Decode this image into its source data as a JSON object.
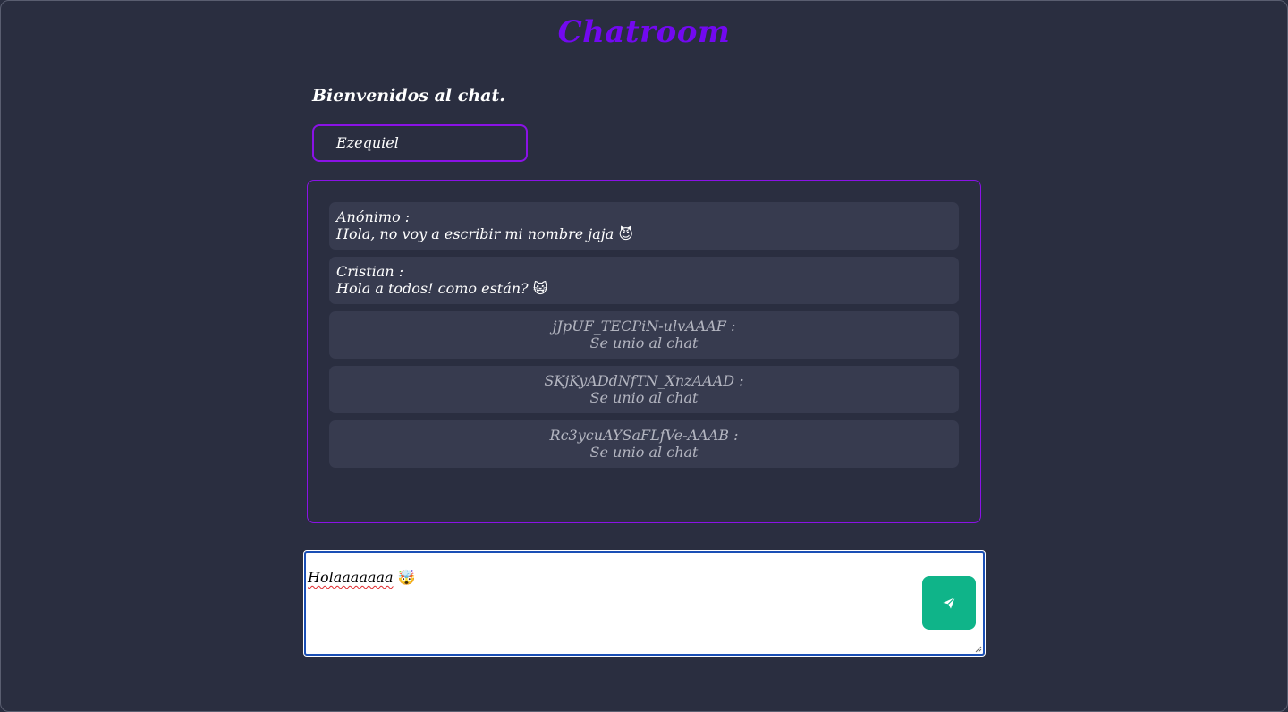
{
  "page": {
    "title": "Chatroom",
    "welcome": "Bienvenidos al chat."
  },
  "user": {
    "name": "Ezequiel"
  },
  "messages": [
    {
      "author": "Anónimo :",
      "text": "Hola, no voy a escribir mi nombre jaja",
      "emoji": "😈",
      "type": "message"
    },
    {
      "author": "Cristian :",
      "text": "Hola a todos! como están?",
      "emoji": "😺",
      "type": "message"
    },
    {
      "author": "jJpUF_TECPiN-ulvAAAF :",
      "text": "Se unio al chat",
      "type": "join"
    },
    {
      "author": "SKjKyADdNfTN_XnzAAAD :",
      "text": "Se unio al chat",
      "type": "join"
    },
    {
      "author": "Rc3ycuAYSaFLfVe-AAAB :",
      "text": "Se unio al chat",
      "type": "join"
    }
  ],
  "composer": {
    "value": "Holaaaaaaa",
    "emoji": "🤯",
    "send_icon": "paper-plane-icon"
  },
  "colors": {
    "background": "#2a2e40",
    "accent": "#7209f0",
    "border": "#8a12e6",
    "message_bg": "#373b4f",
    "send_button": "#0fb489"
  }
}
